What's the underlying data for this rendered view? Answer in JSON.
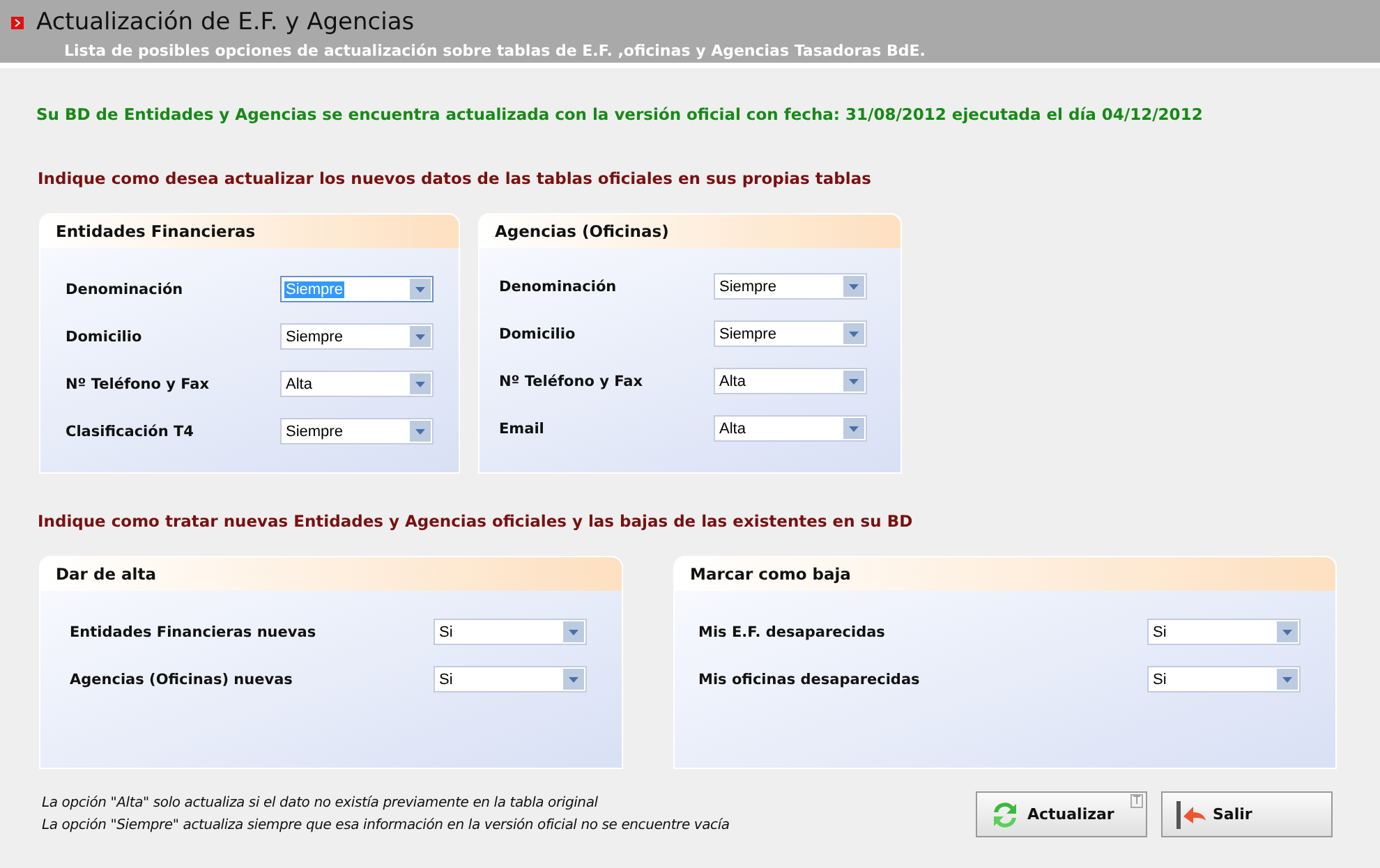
{
  "header": {
    "title": "Actualización de E.F. y Agencias",
    "subtitle": "Lista de posibles opciones de actualización sobre tablas de E.F. ,oficinas y Agencias Tasadoras BdE."
  },
  "status_message": "Su BD de Entidades y Agencias se encuentra actualizada con la versión oficial con fecha: 31/08/2012 ejecutada el día 04/12/2012",
  "update_heading": "Indique como desea actualizar los nuevos datos de las tablas oficiales en sus propias tablas",
  "update_groups": [
    {
      "title": "Entidades Financieras",
      "fields": [
        {
          "label": "Denominación",
          "value": "Siempre",
          "focused": true
        },
        {
          "label": "Domicilio",
          "value": "Siempre",
          "focused": false
        },
        {
          "label": "Nº Teléfono y Fax",
          "value": "Alta",
          "focused": false
        },
        {
          "label": "Clasificación T4",
          "value": "Siempre",
          "focused": false
        }
      ]
    },
    {
      "title": "Agencias (Oficinas)",
      "fields": [
        {
          "label": "Denominación",
          "value": "Siempre",
          "focused": false
        },
        {
          "label": "Domicilio",
          "value": "Siempre",
          "focused": false
        },
        {
          "label": "Nº Teléfono y Fax",
          "value": "Alta",
          "focused": false
        },
        {
          "label": "Email",
          "value": "Alta",
          "focused": false
        }
      ]
    }
  ],
  "status_heading": "Indique como tratar nuevas Entidades y Agencias oficiales y las bajas de las existentes en su BD",
  "status_groups": [
    {
      "title": "Dar de alta",
      "fields": [
        {
          "label": "Entidades Financieras nuevas",
          "value": "Si",
          "focused": false
        },
        {
          "label": "Agencias (Oficinas) nuevas",
          "value": "Si",
          "focused": false
        }
      ]
    },
    {
      "title": "Marcar como baja",
      "fields": [
        {
          "label": "Mis E.F. desaparecidas",
          "value": "Si",
          "focused": false
        },
        {
          "label": "Mis oficinas desaparecidas",
          "value": "Si",
          "focused": false
        }
      ]
    }
  ],
  "notes": [
    "La opción \"Alta\" solo actualiza si el dato no existía previamente en la tabla original",
    "La opción \"Siempre\" actualiza siempre que esa información en la versión oficial no se encuentre vacía"
  ],
  "buttons": [
    {
      "kind": "update",
      "label": "Actualizar",
      "corner_mark": "T"
    },
    {
      "kind": "exit",
      "label": "Salir"
    }
  ]
}
